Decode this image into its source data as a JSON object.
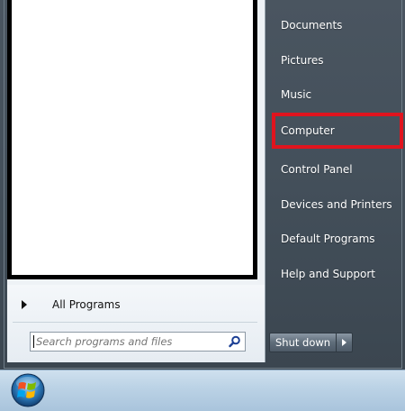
{
  "left_pane": {
    "all_programs_label": "All Programs",
    "search": {
      "placeholder": "Search programs and files",
      "value": ""
    }
  },
  "right_pane": {
    "items": [
      {
        "label": "Documents"
      },
      {
        "label": "Pictures"
      },
      {
        "label": "Music"
      },
      {
        "label": "Computer"
      },
      {
        "label": "Control Panel"
      },
      {
        "label": "Devices and Printers"
      },
      {
        "label": "Default Programs"
      },
      {
        "label": "Help and Support"
      }
    ],
    "highlighted_item": "Computer"
  },
  "shutdown": {
    "label": "Shut down"
  },
  "icons": {
    "search": "search-icon",
    "all_programs_arrow": "arrow-right-icon",
    "shutdown_options": "chevron-right-icon",
    "start": "windows-logo-icon"
  },
  "colors": {
    "highlight_border": "#e0141e",
    "right_pane_bg": "#44505b",
    "taskbar_bg": "#bcd3e6"
  }
}
